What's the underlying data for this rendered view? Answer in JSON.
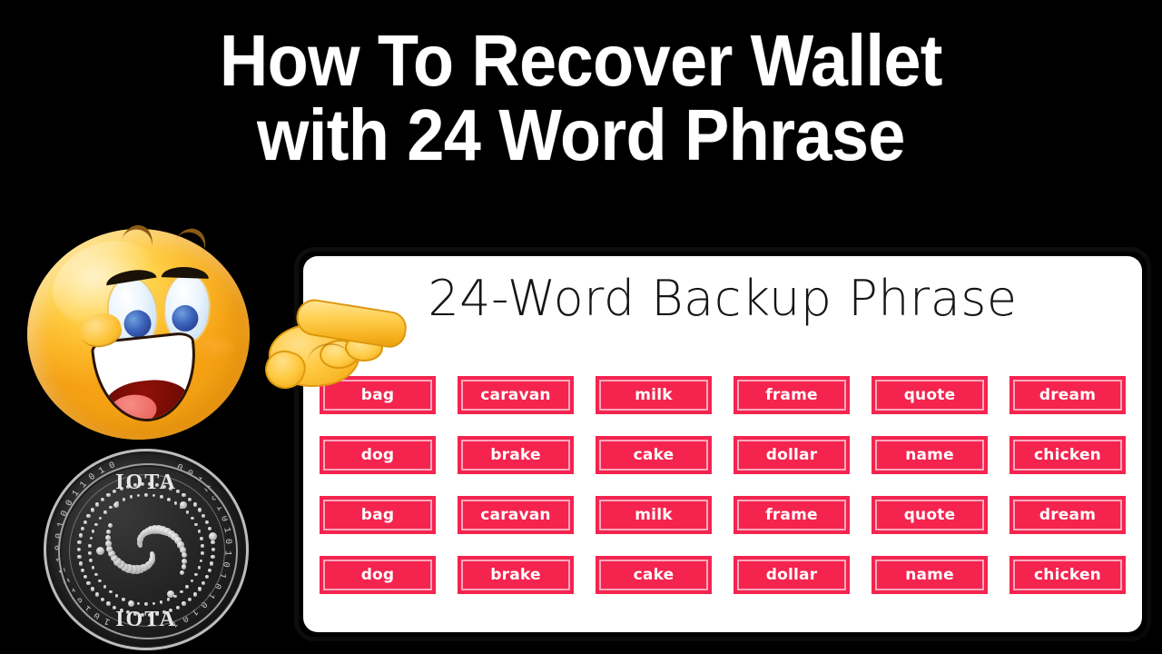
{
  "thumbnail": {
    "headline_line1": "How To Recover Wallet",
    "headline_line2": "with 24 Word Phrase",
    "background_color": "#000000",
    "headline_color": "#ffffff"
  },
  "emoji": {
    "smiley_name": "grinning-smiley-face",
    "hand_name": "pointing-right-hand"
  },
  "coin": {
    "name": "IOTA",
    "label_top": "IOTA",
    "label_bottom": "IOTA",
    "rim_text": "0010011010101010101010100010101111",
    "body_color": "#1a1a1a",
    "accent_color": "#d2d2d2"
  },
  "card": {
    "title": "24-Word Backup Phrase",
    "background_color": "#ffffff",
    "border_color": "#0d0d0d",
    "chip_color": "#F4244F",
    "chip_inner_border_color": "#f9a8bc",
    "chip_text_color": "#ffffff",
    "columns": 6,
    "rows": 4,
    "words": [
      "bag",
      "caravan",
      "milk",
      "frame",
      "quote",
      "dream",
      "dog",
      "brake",
      "cake",
      "dollar",
      "name",
      "chicken",
      "bag",
      "caravan",
      "milk",
      "frame",
      "quote",
      "dream",
      "dog",
      "brake",
      "cake",
      "dollar",
      "name",
      "chicken"
    ]
  }
}
